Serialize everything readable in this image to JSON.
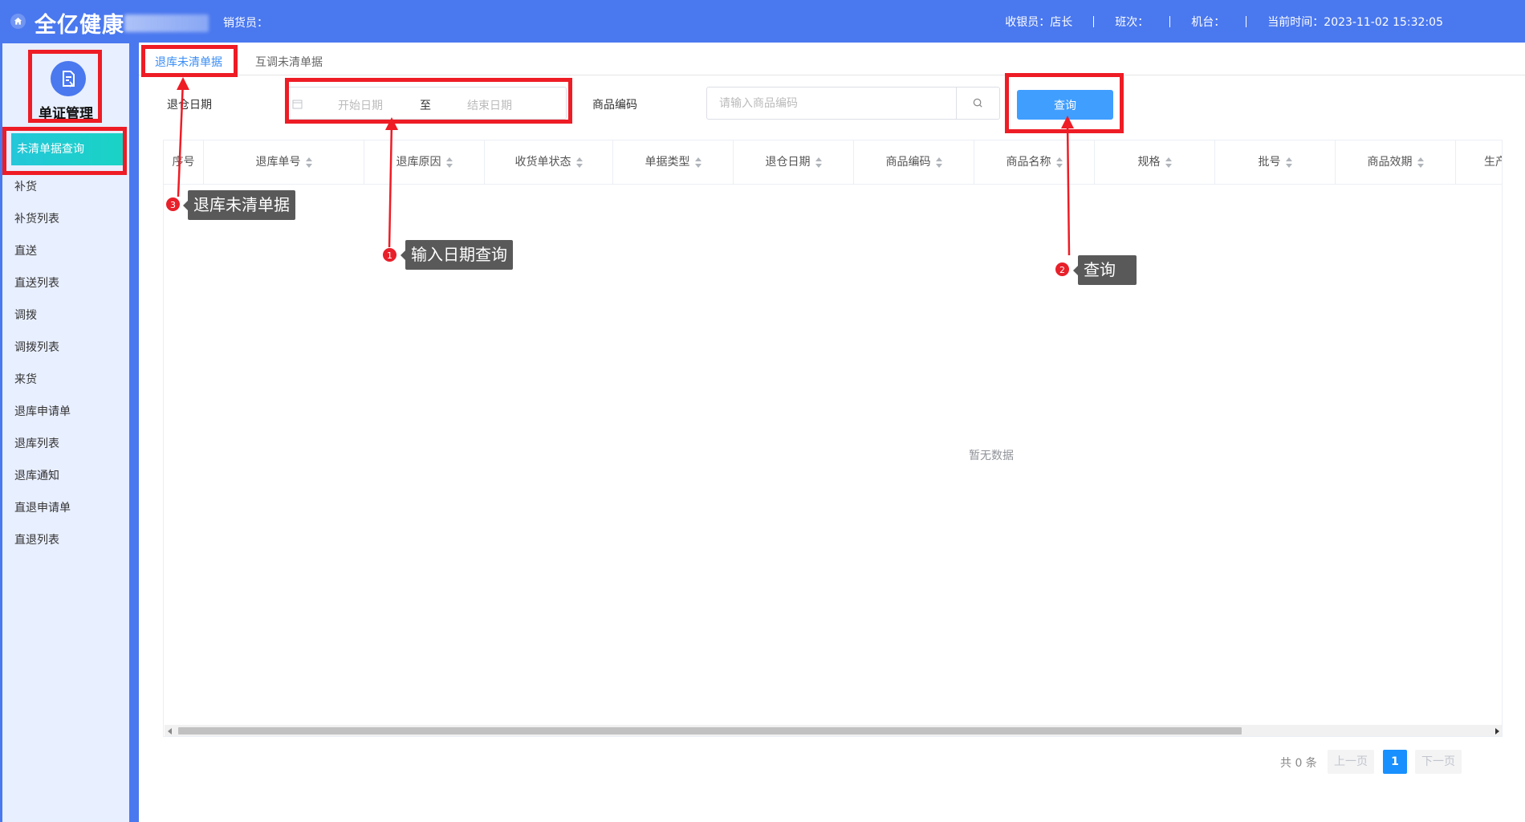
{
  "header": {
    "brand": "全亿健康",
    "salesperson_label": "销货员：",
    "cashier": "收银员：店长",
    "shift": "班次：",
    "terminal": "机台：",
    "current_time": "当前时间：2023-11-02 15:32:05",
    "color": "#4a78ef"
  },
  "sidebar": {
    "module_title": "单证管理",
    "active_item": "未清单据查询",
    "items": [
      {
        "label": "补货"
      },
      {
        "label": "补货列表"
      },
      {
        "label": "直送"
      },
      {
        "label": "直送列表"
      },
      {
        "label": "调拨"
      },
      {
        "label": "调拨列表"
      },
      {
        "label": "来货"
      },
      {
        "label": "退库申请单"
      },
      {
        "label": "退库列表"
      },
      {
        "label": "退库通知"
      },
      {
        "label": "直退申请单"
      },
      {
        "label": "直退列表"
      }
    ]
  },
  "tabs": [
    {
      "label": "退库未清单据",
      "active": true
    },
    {
      "label": "互调未清单据",
      "active": false
    }
  ],
  "filters": {
    "date_label": "退仓日期",
    "date_start_placeholder": "开始日期",
    "date_separator": "至",
    "date_end_placeholder": "结束日期",
    "code_label": "商品编码",
    "code_placeholder": "请输入商品编码",
    "query_button": "查询"
  },
  "table": {
    "columns": [
      {
        "label": "序号",
        "sortable": false
      },
      {
        "label": "退库单号",
        "sortable": true
      },
      {
        "label": "退库原因",
        "sortable": true
      },
      {
        "label": "收货单状态",
        "sortable": true
      },
      {
        "label": "单据类型",
        "sortable": true
      },
      {
        "label": "退仓日期",
        "sortable": true
      },
      {
        "label": "商品编码",
        "sortable": true
      },
      {
        "label": "商品名称",
        "sortable": true
      },
      {
        "label": "规格",
        "sortable": true
      },
      {
        "label": "批号",
        "sortable": true
      },
      {
        "label": "商品效期",
        "sortable": true
      },
      {
        "label": "生产",
        "sortable": false
      }
    ],
    "rows": [],
    "empty_text": "暂无数据"
  },
  "pagination": {
    "total": "共 0 条",
    "prev": "上一页",
    "current_page": "1",
    "next": "下一页"
  },
  "annotations": [
    {
      "step": "1",
      "text": "输入日期查询"
    },
    {
      "step": "2",
      "text": "查询"
    },
    {
      "step": "3",
      "text": "退库未清单据"
    }
  ],
  "colors": {
    "annotation_red": "#ee1c25",
    "primary_button": "#409eff",
    "active_tab": "#3a8ef6"
  }
}
